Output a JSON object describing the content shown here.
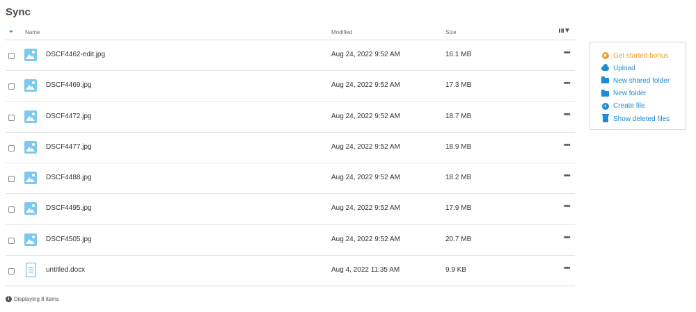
{
  "page": {
    "title": "Sync"
  },
  "columns": {
    "name": "Name",
    "modified": "Modified",
    "size": "Size"
  },
  "files": [
    {
      "name": "DSCF4462-edit.jpg",
      "modified": "Aug 24, 2022 9:52 AM",
      "size": "16.1 MB",
      "type": "image-icon"
    },
    {
      "name": "DSCF4469.jpg",
      "modified": "Aug 24, 2022 9:52 AM",
      "size": "17.3 MB",
      "type": "image-icon"
    },
    {
      "name": "DSCF4472.jpg",
      "modified": "Aug 24, 2022 9:52 AM",
      "size": "18.7 MB",
      "type": "image-icon"
    },
    {
      "name": "DSCF4477.jpg",
      "modified": "Aug 24, 2022 9:52 AM",
      "size": "18.9 MB",
      "type": "image-icon"
    },
    {
      "name": "DSCF4488.jpg",
      "modified": "Aug 24, 2022 9:52 AM",
      "size": "18.2 MB",
      "type": "image-icon"
    },
    {
      "name": "DSCF4495.jpg",
      "modified": "Aug 24, 2022 9:52 AM",
      "size": "17.9 MB",
      "type": "image-icon"
    },
    {
      "name": "DSCF4505.jpg",
      "modified": "Aug 24, 2022 9:52 AM",
      "size": "20.7 MB",
      "type": "image-icon"
    },
    {
      "name": "untitled.docx",
      "modified": "Aug 4, 2022 11:35 AM",
      "size": "9.9 KB",
      "type": "document-icon"
    }
  ],
  "row_menu_glyph": "•••",
  "footer": {
    "status": "Displaying 8 items",
    "info_glyph": "i"
  },
  "actions": [
    {
      "label": "Get started bonus",
      "icon": "star-icon",
      "glyph": "★"
    },
    {
      "label": "Upload",
      "icon": "cloud-upload-icon"
    },
    {
      "label": "New shared folder",
      "icon": "shared-folder-icon"
    },
    {
      "label": "New folder",
      "icon": "folder-icon"
    },
    {
      "label": "Create file",
      "icon": "plus-circle-icon",
      "glyph": "+"
    },
    {
      "label": "Show deleted files",
      "icon": "trash-icon"
    }
  ],
  "colors": {
    "accent": "#1f8ad6",
    "bonus": "#e8a126",
    "image_icon": "#7cc8f0"
  }
}
